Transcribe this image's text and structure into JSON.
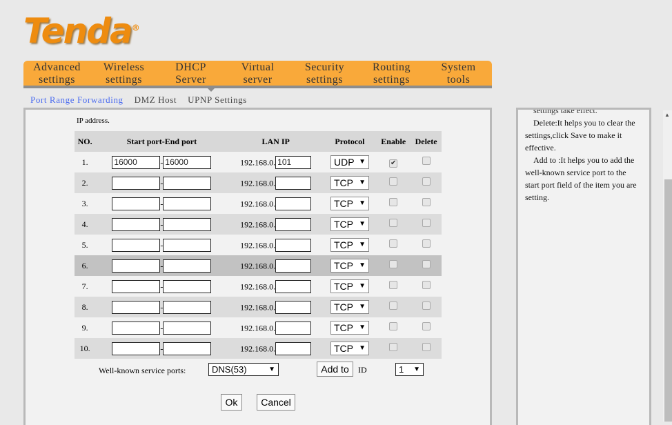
{
  "logo": "Tenda",
  "nav": [
    {
      "l1": "Advanced",
      "l2": "settings"
    },
    {
      "l1": "Wireless",
      "l2": "settings"
    },
    {
      "l1": "DHCP",
      "l2": "Server"
    },
    {
      "l1": "Virtual",
      "l2": "server"
    },
    {
      "l1": "Security",
      "l2": "settings"
    },
    {
      "l1": "Routing",
      "l2": "settings"
    },
    {
      "l1": "System",
      "l2": "tools"
    }
  ],
  "subnav": [
    "Port Range Forwarding",
    "DMZ Host",
    "UPNP Settings"
  ],
  "ip_note": "IP address.",
  "table": {
    "headers": [
      "NO.",
      "Start port-End port",
      "LAN IP",
      "Protocol",
      "Enable",
      "Delete"
    ],
    "ip_prefix": "192.168.0.",
    "rows": [
      {
        "no": "1.",
        "start": "16000",
        "end": "16000",
        "ip": "101",
        "protocol": "UDP",
        "enable": true,
        "delete": false
      },
      {
        "no": "2.",
        "start": "",
        "end": "",
        "ip": "",
        "protocol": "TCP",
        "enable": false,
        "delete": false
      },
      {
        "no": "3.",
        "start": "",
        "end": "",
        "ip": "",
        "protocol": "TCP",
        "enable": false,
        "delete": false
      },
      {
        "no": "4.",
        "start": "",
        "end": "",
        "ip": "",
        "protocol": "TCP",
        "enable": false,
        "delete": false
      },
      {
        "no": "5.",
        "start": "",
        "end": "",
        "ip": "",
        "protocol": "TCP",
        "enable": false,
        "delete": false
      },
      {
        "no": "6.",
        "start": "",
        "end": "",
        "ip": "",
        "protocol": "TCP",
        "enable": false,
        "delete": false
      },
      {
        "no": "7.",
        "start": "",
        "end": "",
        "ip": "",
        "protocol": "TCP",
        "enable": false,
        "delete": false
      },
      {
        "no": "8.",
        "start": "",
        "end": "",
        "ip": "",
        "protocol": "TCP",
        "enable": false,
        "delete": false
      },
      {
        "no": "9.",
        "start": "",
        "end": "",
        "ip": "",
        "protocol": "TCP",
        "enable": false,
        "delete": false
      },
      {
        "no": "10.",
        "start": "",
        "end": "",
        "ip": "",
        "protocol": "TCP",
        "enable": false,
        "delete": false
      }
    ]
  },
  "wellknown": {
    "label": "Well-known service ports:",
    "value": "DNS(53)",
    "add_label": "Add to",
    "id_label": "ID",
    "id_value": "1"
  },
  "ok_label": "Ok",
  "cancel_label": "Cancel",
  "help": {
    "cut": "settings take effect.",
    "p1": "Delete:It helps you to clear the settings,click Save to make it effective.",
    "p2": "Add to :It helps you to add the well-known service port to the start port field of the item you are setting."
  },
  "colors": {
    "nav": "#f9a93a",
    "logo": "#ee8c10",
    "active_link": "#4a6bf0"
  }
}
